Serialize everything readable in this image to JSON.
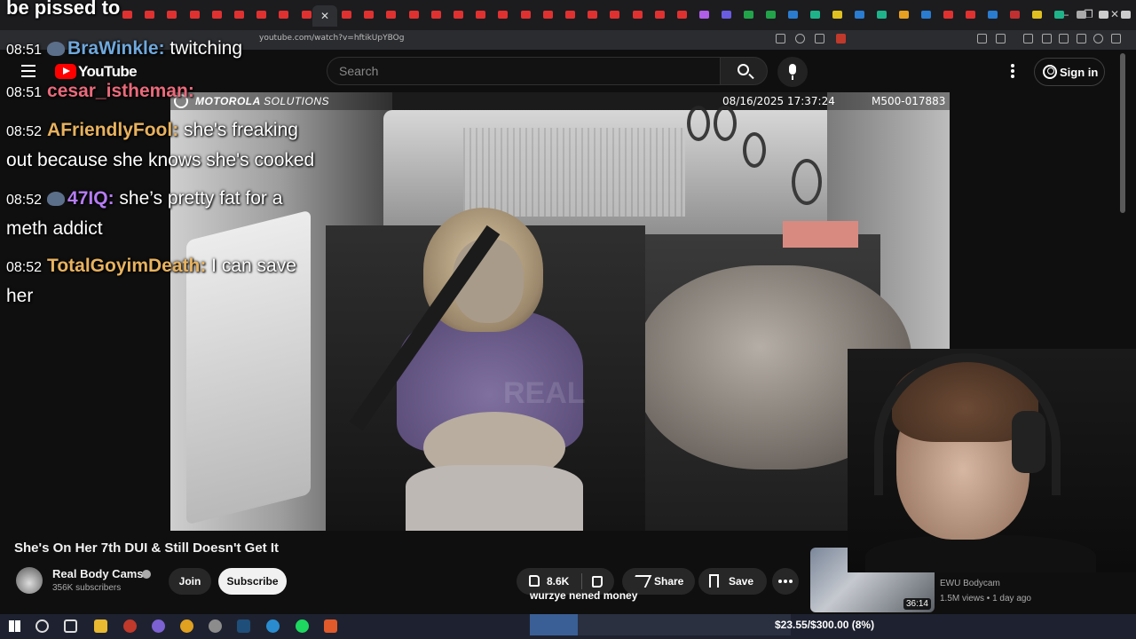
{
  "browser": {
    "url": "youtube.com/watch?v=hftikUpYBOg",
    "active_tab_close": "✕",
    "new_tab": "+",
    "window_controls": [
      "—",
      "❐",
      "✕"
    ]
  },
  "youtube": {
    "logo_text": "YouTube",
    "search_placeholder": "Search",
    "signin_label": "Sign in"
  },
  "video": {
    "overlay_brand": "MOTOROLA",
    "overlay_brand_suffix": "SOLUTIONS",
    "overlay_timestamp": "08/16/2025 17:37:24",
    "overlay_camera_id": "M500-017883",
    "watermark": "REAL"
  },
  "chat": {
    "top_text": "be pissed to",
    "messages": [
      {
        "time": "08:51",
        "user": "BraWinkle",
        "color": "#6fa8dc",
        "text": "twitching",
        "emote": true
      },
      {
        "time": "08:51",
        "user": "cesar_istheman",
        "color": "#ea6a7b",
        "text": "",
        "emote": false
      },
      {
        "time": "08:52",
        "user": "AFriendlyFool",
        "color": "#e8b25e",
        "text": "she's freaking",
        "emote": false
      },
      {
        "time": "08:52",
        "user": "47IQ",
        "color": "#b67cf5",
        "text": "she’s pretty fat for a",
        "emote": true
      },
      {
        "time": "08:52",
        "user": "TotalGoyimDeath",
        "color": "#e8b25e",
        "text": "I can save",
        "emote": false
      }
    ],
    "continuations": [
      "out because she knows she's cooked",
      "meth addict",
      "her"
    ]
  },
  "info": {
    "title": "She's On Her 7th DUI & Still Doesn't Get It",
    "channel_name": "Real Body Cams",
    "subscribers": "356K subscribers",
    "join_label": "Join",
    "subscribe_label": "Subscribe",
    "like_count": "8.6K",
    "share_label": "Share",
    "save_label": "Save",
    "overlay_text": "wurzye nened money"
  },
  "recommendation": {
    "duration": "36:14",
    "channel": "EWU Bodycam",
    "meta": "1.5M views • 1 day ago"
  },
  "taskbar": {
    "donation_text": "$23.55/$300.00 (8%)",
    "donation_progress": 0.08
  }
}
